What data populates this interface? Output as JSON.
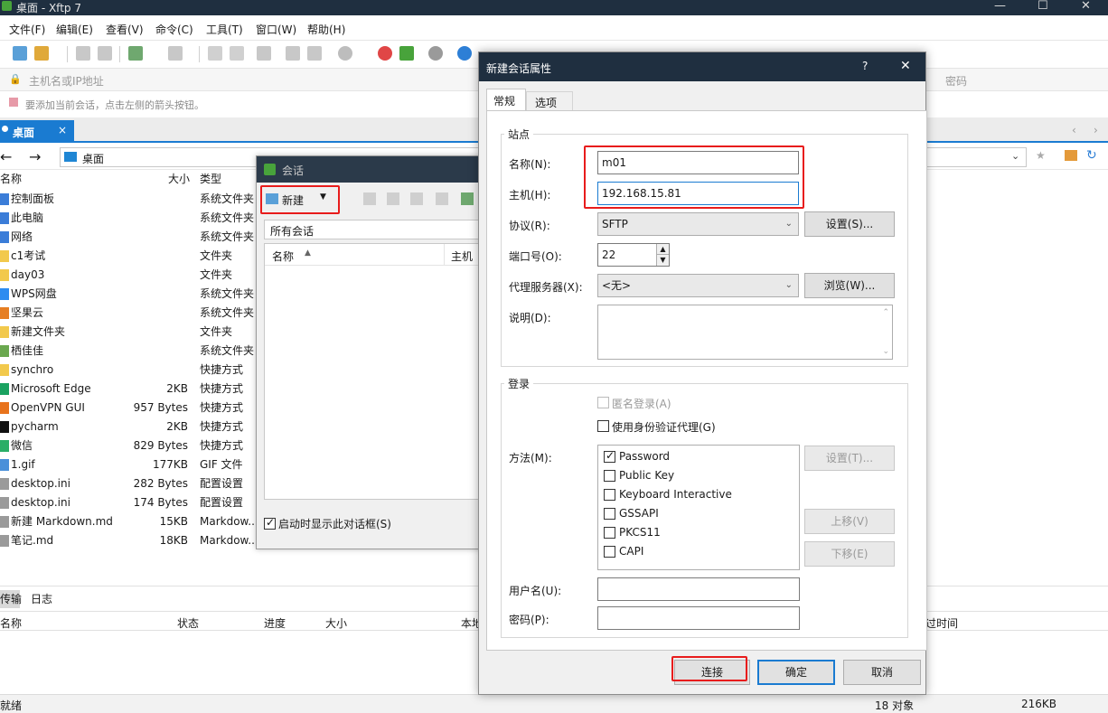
{
  "app": {
    "title": "桌面 - Xftp 7"
  },
  "menu": [
    "文件(F)",
    "编辑(E)",
    "查看(V)",
    "命令(C)",
    "工具(T)",
    "窗口(W)",
    "帮助(H)"
  ],
  "address": {
    "host_placeholder": "主机名或IP地址",
    "password_placeholder": "密码"
  },
  "hint": "要添加当前会话，点击左侧的箭头按钮。",
  "tab": {
    "label": "桌面",
    "close": "×"
  },
  "nav": {
    "path": "桌面"
  },
  "columns": {
    "name": "名称",
    "size": "大小",
    "type": "类型"
  },
  "files": [
    {
      "name": "控制面板",
      "size": "",
      "type": "系统文件夹",
      "color": "#3b7dd8"
    },
    {
      "name": "此电脑",
      "size": "",
      "type": "系统文件夹",
      "color": "#3b7dd8"
    },
    {
      "name": "网络",
      "size": "",
      "type": "系统文件夹",
      "color": "#3b7dd8"
    },
    {
      "name": "c1考试",
      "size": "",
      "type": "文件夹",
      "color": "#f2c94c"
    },
    {
      "name": "day03",
      "size": "",
      "type": "文件夹",
      "color": "#f2c94c"
    },
    {
      "name": "WPS网盘",
      "size": "",
      "type": "系统文件夹",
      "color": "#2d8cf0"
    },
    {
      "name": "坚果云",
      "size": "",
      "type": "系统文件夹",
      "color": "#e67e22"
    },
    {
      "name": "新建文件夹",
      "size": "",
      "type": "文件夹",
      "color": "#f2c94c"
    },
    {
      "name": "栖佳佳",
      "size": "",
      "type": "系统文件夹",
      "color": "#6aa84f"
    },
    {
      "name": "synchro",
      "size": "",
      "type": "快捷方式",
      "color": "#f2c94c"
    },
    {
      "name": "Microsoft Edge",
      "size": "2KB",
      "type": "快捷方式",
      "color": "#1aa260"
    },
    {
      "name": "OpenVPN GUI",
      "size": "957 Bytes",
      "type": "快捷方式",
      "color": "#e8731c"
    },
    {
      "name": "pycharm",
      "size": "2KB",
      "type": "快捷方式",
      "color": "#111111"
    },
    {
      "name": "微信",
      "size": "829 Bytes",
      "type": "快捷方式",
      "color": "#2aae67"
    },
    {
      "name": "1.gif",
      "size": "177KB",
      "type": "GIF 文件",
      "color": "#4a90d9"
    },
    {
      "name": "desktop.ini",
      "size": "282 Bytes",
      "type": "配置设置",
      "color": "#9a9a9a"
    },
    {
      "name": "desktop.ini",
      "size": "174 Bytes",
      "type": "配置设置",
      "color": "#9a9a9a"
    },
    {
      "name": "新建 Markdown.md",
      "size": "15KB",
      "type": "Markdow...",
      "color": "#9a9a9a"
    },
    {
      "name": "笔记.md",
      "size": "18KB",
      "type": "Markdow...",
      "color": "#9a9a9a"
    }
  ],
  "bottom": {
    "tabs": [
      "传输",
      "日志"
    ],
    "cols": [
      "名称",
      "状态",
      "进度",
      "大小",
      "本地"
    ],
    "right_col": "过时间"
  },
  "status": {
    "left": "就绪",
    "objects": "18 对象",
    "size": "216KB"
  },
  "session": {
    "title": "会话",
    "new_label": "新建",
    "all_sessions": "所有会话",
    "col_name": "名称",
    "col_host": "主机",
    "startup_label": "启动时显示此对话框(S)"
  },
  "props": {
    "title": "新建会话属性",
    "help": "?",
    "close": "✕",
    "tabs": [
      "常规",
      "选项"
    ],
    "site_group": "站点",
    "name_label": "名称(N):",
    "name_value": "m01",
    "host_label": "主机(H):",
    "host_value": "192.168.15.81",
    "protocol_label": "协议(R):",
    "protocol_value": "SFTP",
    "settings_btn": "设置(S)...",
    "port_label": "端口号(O):",
    "port_value": "22",
    "proxy_label": "代理服务器(X):",
    "proxy_value": "<无>",
    "browse_btn": "浏览(W)...",
    "desc_label": "说明(D):",
    "login_group": "登录",
    "anon_label": "匿名登录(A)",
    "agent_label": "使用身份验证代理(G)",
    "method_label": "方法(M):",
    "methods": [
      {
        "label": "Password",
        "checked": true
      },
      {
        "label": "Public Key",
        "checked": false
      },
      {
        "label": "Keyboard Interactive",
        "checked": false
      },
      {
        "label": "GSSAPI",
        "checked": false
      },
      {
        "label": "PKCS11",
        "checked": false
      },
      {
        "label": "CAPI",
        "checked": false
      }
    ],
    "method_settings_btn": "设置(T)...",
    "move_up_btn": "上移(V)",
    "move_down_btn": "下移(E)",
    "user_label": "用户名(U):",
    "pass_label": "密码(P):",
    "connect_btn": "连接",
    "ok_btn": "确定",
    "cancel_btn": "取消"
  },
  "colors": {
    "titlebar": "#1f2f40",
    "accent": "#1a7bd1",
    "highlight": "#e81c1c"
  }
}
